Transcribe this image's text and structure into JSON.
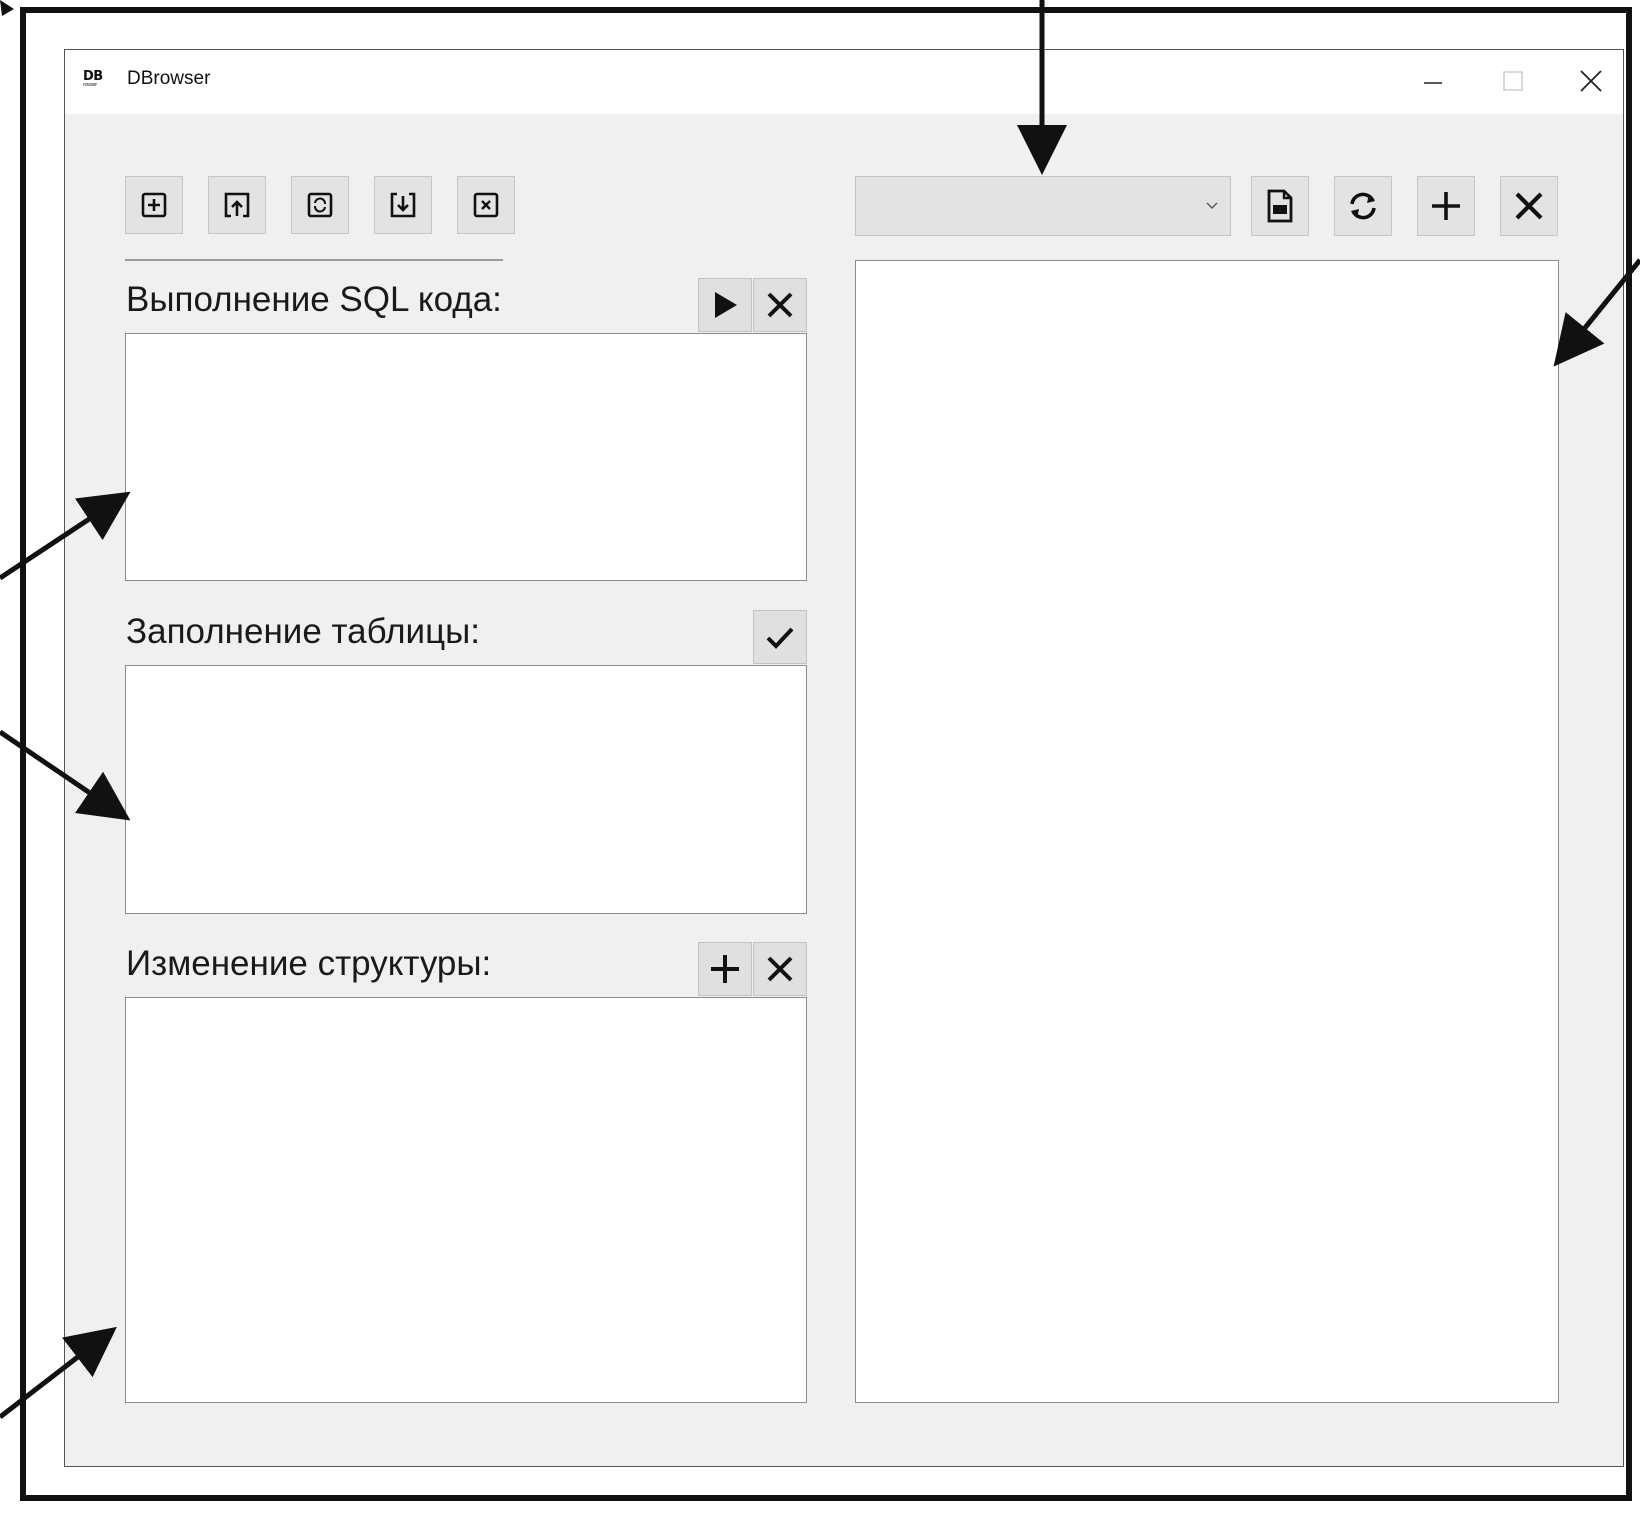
{
  "window": {
    "logo_text": "DB",
    "logo_sub": "rowser",
    "title": "DBrowser"
  },
  "toolbar": {
    "buttons": [
      "new-db-icon",
      "open-db-icon",
      "refresh-db-icon",
      "save-db-icon",
      "close-db-icon"
    ]
  },
  "sections": {
    "sql": {
      "label": "Выполнение SQL кода:"
    },
    "fill": {
      "label": "Заполнение таблицы:"
    },
    "structure": {
      "label": "Изменение структуры:"
    }
  },
  "right_panel": {
    "table_select_value": "",
    "buttons": [
      "csv-export-icon",
      "refresh-icon",
      "add-icon",
      "delete-icon"
    ]
  },
  "colors": {
    "window_bg": "#f0f0f0",
    "titlebar_bg": "#ffffff",
    "button_bg": "#e3e3e3",
    "input_bg": "#ffffff",
    "annotation": "#111111"
  }
}
